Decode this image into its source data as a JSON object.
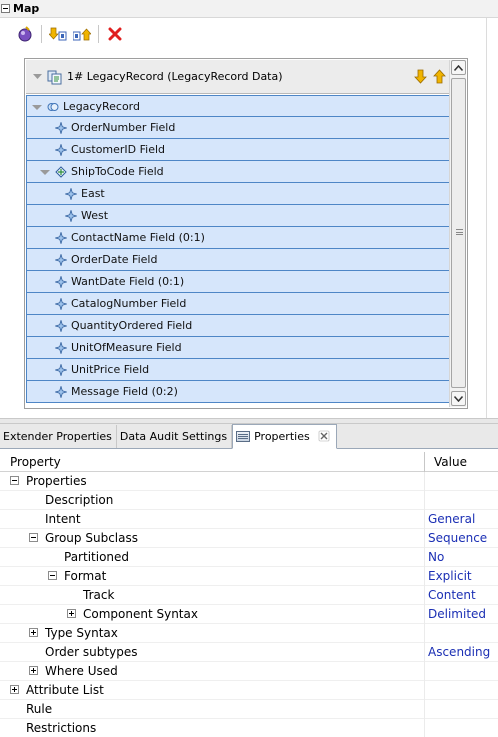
{
  "map": {
    "title": "Map",
    "toolbar": {
      "buttons": [
        "orb-icon",
        "sort-down-icon",
        "sort-up-icon",
        "delete-icon"
      ]
    },
    "record_header": "1# LegacyRecord (LegacyRecord Data)",
    "tree": [
      {
        "label": "LegacyRecord",
        "depth": 0,
        "expander": "open",
        "icon": "group-icon"
      },
      {
        "label": "OrderNumber Field",
        "depth": 1,
        "icon": "field-icon"
      },
      {
        "label": "CustomerID Field",
        "depth": 1,
        "icon": "field-icon"
      },
      {
        "label": "ShipToCode Field",
        "depth": 1,
        "expander": "open",
        "icon": "choice-icon"
      },
      {
        "label": "East",
        "depth": 2,
        "icon": "field-icon"
      },
      {
        "label": "West",
        "depth": 2,
        "icon": "field-icon"
      },
      {
        "label": "ContactName Field (0:1)",
        "depth": 1,
        "icon": "field-icon"
      },
      {
        "label": "OrderDate Field",
        "depth": 1,
        "icon": "field-icon"
      },
      {
        "label": "WantDate Field (0:1)",
        "depth": 1,
        "icon": "field-icon"
      },
      {
        "label": "CatalogNumber Field",
        "depth": 1,
        "icon": "field-icon"
      },
      {
        "label": "QuantityOrdered Field",
        "depth": 1,
        "icon": "field-icon"
      },
      {
        "label": "UnitOfMeasure Field",
        "depth": 1,
        "icon": "field-icon"
      },
      {
        "label": "UnitPrice Field",
        "depth": 1,
        "icon": "field-icon"
      },
      {
        "label": "Message Field (0:2)",
        "depth": 1,
        "icon": "field-icon"
      }
    ]
  },
  "tabs": [
    {
      "label": "Extender Properties",
      "active": false
    },
    {
      "label": "Data Audit Settings",
      "active": false
    },
    {
      "label": "Properties",
      "active": true
    }
  ],
  "properties": {
    "header": {
      "property": "Property",
      "value": "Value"
    },
    "rows": [
      {
        "name": "Properties",
        "value": "",
        "indent": 0,
        "expander": "minus"
      },
      {
        "name": "Description",
        "value": "",
        "indent": 1
      },
      {
        "name": "Intent",
        "value": "General",
        "indent": 1
      },
      {
        "name": "Group Subclass",
        "value": "Sequence",
        "indent": 1,
        "expander": "minus"
      },
      {
        "name": "Partitioned",
        "value": "No",
        "indent": 2
      },
      {
        "name": "Format",
        "value": "Explicit",
        "indent": 2,
        "expander": "minus"
      },
      {
        "name": "Track",
        "value": "Content",
        "indent": 3
      },
      {
        "name": "Component Syntax",
        "value": "Delimited",
        "indent": 3,
        "expander": "plus"
      },
      {
        "name": "Type Syntax",
        "value": "",
        "indent": 1,
        "expander": "plus"
      },
      {
        "name": "Order subtypes",
        "value": "Ascending",
        "indent": 1
      },
      {
        "name": "Where Used",
        "value": "",
        "indent": 1,
        "expander": "plus"
      },
      {
        "name": "Attribute List",
        "value": "",
        "indent": 0,
        "expander": "plus"
      },
      {
        "name": "Rule",
        "value": "",
        "indent": 0
      },
      {
        "name": "Restrictions",
        "value": "",
        "indent": 0
      }
    ]
  },
  "colors": {
    "row_fill": "#d6e6fb",
    "row_border": "#4e86c6",
    "value_text": "#1b2fb4",
    "arrow_orange": "#f0a400",
    "delete_red": "#e02020"
  }
}
